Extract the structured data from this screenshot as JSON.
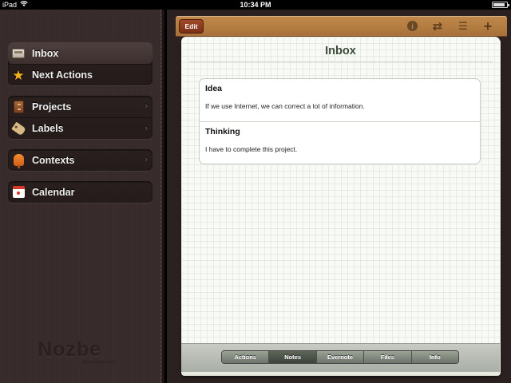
{
  "status_bar": {
    "device": "iPad",
    "time": "10:34 PM",
    "wifi_icon": "wifi-icon",
    "battery_icon": "battery-icon"
  },
  "sidebar": {
    "groups": [
      {
        "items": [
          {
            "label": "Inbox",
            "icon": "inbox-tray-icon",
            "selected": true
          },
          {
            "label": "Next Actions",
            "icon": "star-icon"
          }
        ]
      },
      {
        "items": [
          {
            "label": "Projects",
            "icon": "cabinet-icon"
          },
          {
            "label": "Labels",
            "icon": "tag-icon"
          }
        ]
      },
      {
        "items": [
          {
            "label": "Contexts",
            "icon": "chair-icon"
          }
        ]
      },
      {
        "items": [
          {
            "label": "Calendar",
            "icon": "calendar-icon"
          }
        ]
      }
    ],
    "logo": "Nozbe",
    "logo_sub": "getting things done"
  },
  "toolbar": {
    "edit_label": "Edit",
    "icons": [
      "info-icon",
      "sync-icon",
      "list-icon",
      "add-icon"
    ]
  },
  "main": {
    "title": "Inbox",
    "notes": [
      {
        "title": "Idea",
        "body": "If we use Internet, we can correct a lot of information."
      },
      {
        "title": "Thinking",
        "body": "I have to complete this project."
      }
    ]
  },
  "tabs": [
    {
      "label": "Actions"
    },
    {
      "label": "Notes",
      "active": true
    },
    {
      "label": "Evernote"
    },
    {
      "label": "Files"
    },
    {
      "label": "Info"
    }
  ],
  "colors": {
    "sidebar_bg": "#372b2a",
    "toolbar_wood": "#b57c42",
    "edit_button": "#8e3c20",
    "paper": "#f8faf6"
  }
}
